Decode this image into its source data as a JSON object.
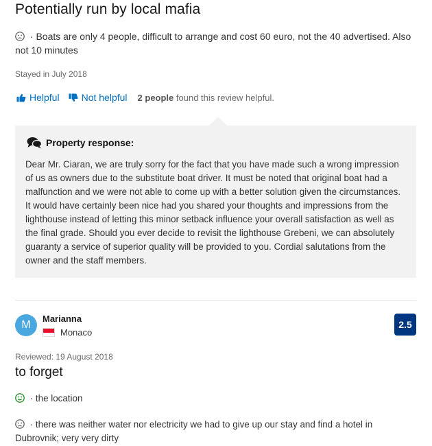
{
  "review1": {
    "title": "Potentially run by local mafia",
    "negative_text": " · Boats are only 4 people, difficult to arrange and cost 60 euro, not the 40 advertised. Also not 10 minutes",
    "stayed": "Stayed in July 2018",
    "helpful_label": "Helpful",
    "not_helpful_label": "Not helpful",
    "helpful_count": "2 people",
    "helpful_suffix": " found this review helpful.",
    "response": {
      "heading": "Property response:",
      "text": "Dear Mr. Ciaran, we are truly sorry for the fact that you have made such a wrong impression of us as owners due to the substitute boat driver. It must be noted that original boat had a malfunction and we were not able to come up with a better solution given the circumstances. It would have certainly been nice had you shared your thoughts and impressions from the lighthouse instead of letting this minor setback influence your overall satisfaction as well as the final grade. Should you ever decide to revisit the lighthouse Grebeni, we can absolutely guaranty a service of superior quality will be provided to you. Cordial salutations from the owner and the staff members."
    }
  },
  "review2": {
    "avatar_letter": "M",
    "reviewer_name": "Marianna",
    "country": "Monaco",
    "score": "2.5",
    "reviewed": "Reviewed: 19 August 2018",
    "title": "to forget",
    "positive_text": " · the location",
    "negative_text": " · there was neither water nor electricity we had to give up our stay and find a hotel in Dubrovnik; very very dirty"
  },
  "colors": {
    "link": "#0071c2",
    "score_bg": "#003580",
    "avatar_bg": "#4aa8e0",
    "positive": "#008009",
    "negative": "#6b6b6b",
    "response_bg": "#f2f2f2"
  },
  "icons": {
    "neutral_face": "sad-face-icon",
    "positive_face": "smile-face-icon",
    "thumbs_up": "thumbs-up-icon",
    "thumbs_down": "thumbs-down-icon",
    "chat": "chat-bubbles-icon"
  }
}
